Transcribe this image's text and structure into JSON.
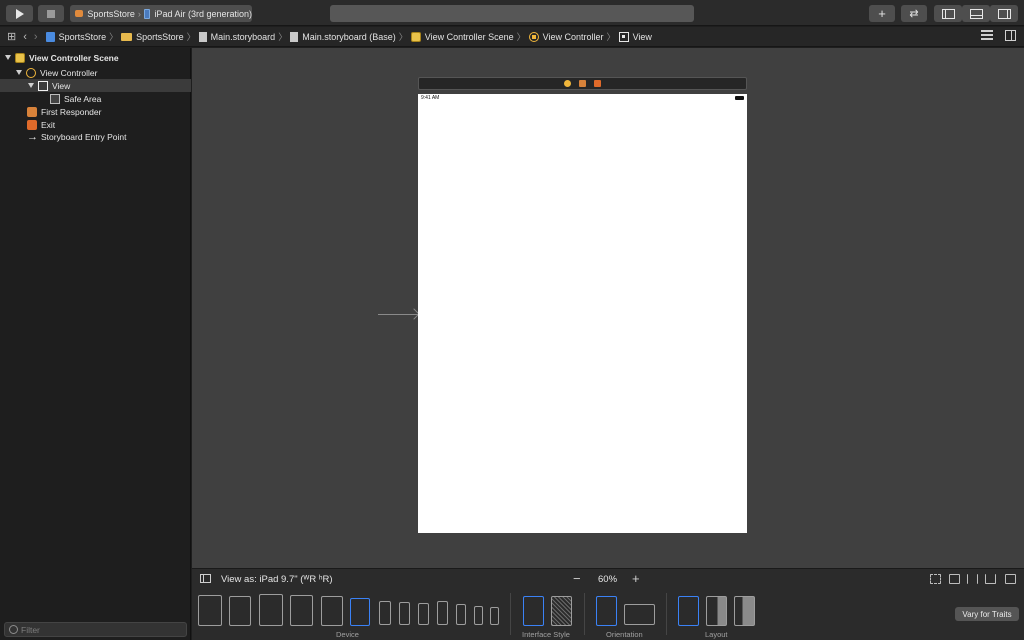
{
  "toolbar": {
    "scheme": "SportsStore",
    "destination": "iPad Air (3rd generation)",
    "add_label": "+",
    "review_label": "⇄"
  },
  "jumpbar": {
    "crumbs": [
      "SportsStore",
      "SportsStore",
      "Main.storyboard",
      "Main.storyboard (Base)",
      "View Controller Scene",
      "View Controller",
      "View"
    ]
  },
  "outline": {
    "items": [
      {
        "label": "View Controller Scene",
        "icon": "scene-icon"
      },
      {
        "label": "View Controller",
        "icon": "view-controller-icon"
      },
      {
        "label": "View",
        "icon": "view-icon",
        "selected": true
      },
      {
        "label": "Safe Area",
        "icon": "safe-area-icon"
      },
      {
        "label": "First Responder",
        "icon": "first-responder-icon"
      },
      {
        "label": "Exit",
        "icon": "exit-icon"
      },
      {
        "label": "Storyboard Entry Point",
        "icon": "arrow-right-icon"
      }
    ],
    "filter_placeholder": "Filter"
  },
  "canvas": {
    "status_time": "9:41 AM"
  },
  "viewas": {
    "label": "View as: iPad 9.7\" (ᵂR ʰR)",
    "zoom_out": "−",
    "zoom": "60%",
    "zoom_in": "+"
  },
  "traits": {
    "device_label": "Device",
    "style_label": "Interface Style",
    "orientation_label": "Orientation",
    "layout_label": "Layout",
    "vary_button": "Vary for Traits"
  },
  "colors": {
    "accent": "#3b82f6",
    "canvas_bg": "#404040",
    "selection": "#3b3b3b"
  }
}
